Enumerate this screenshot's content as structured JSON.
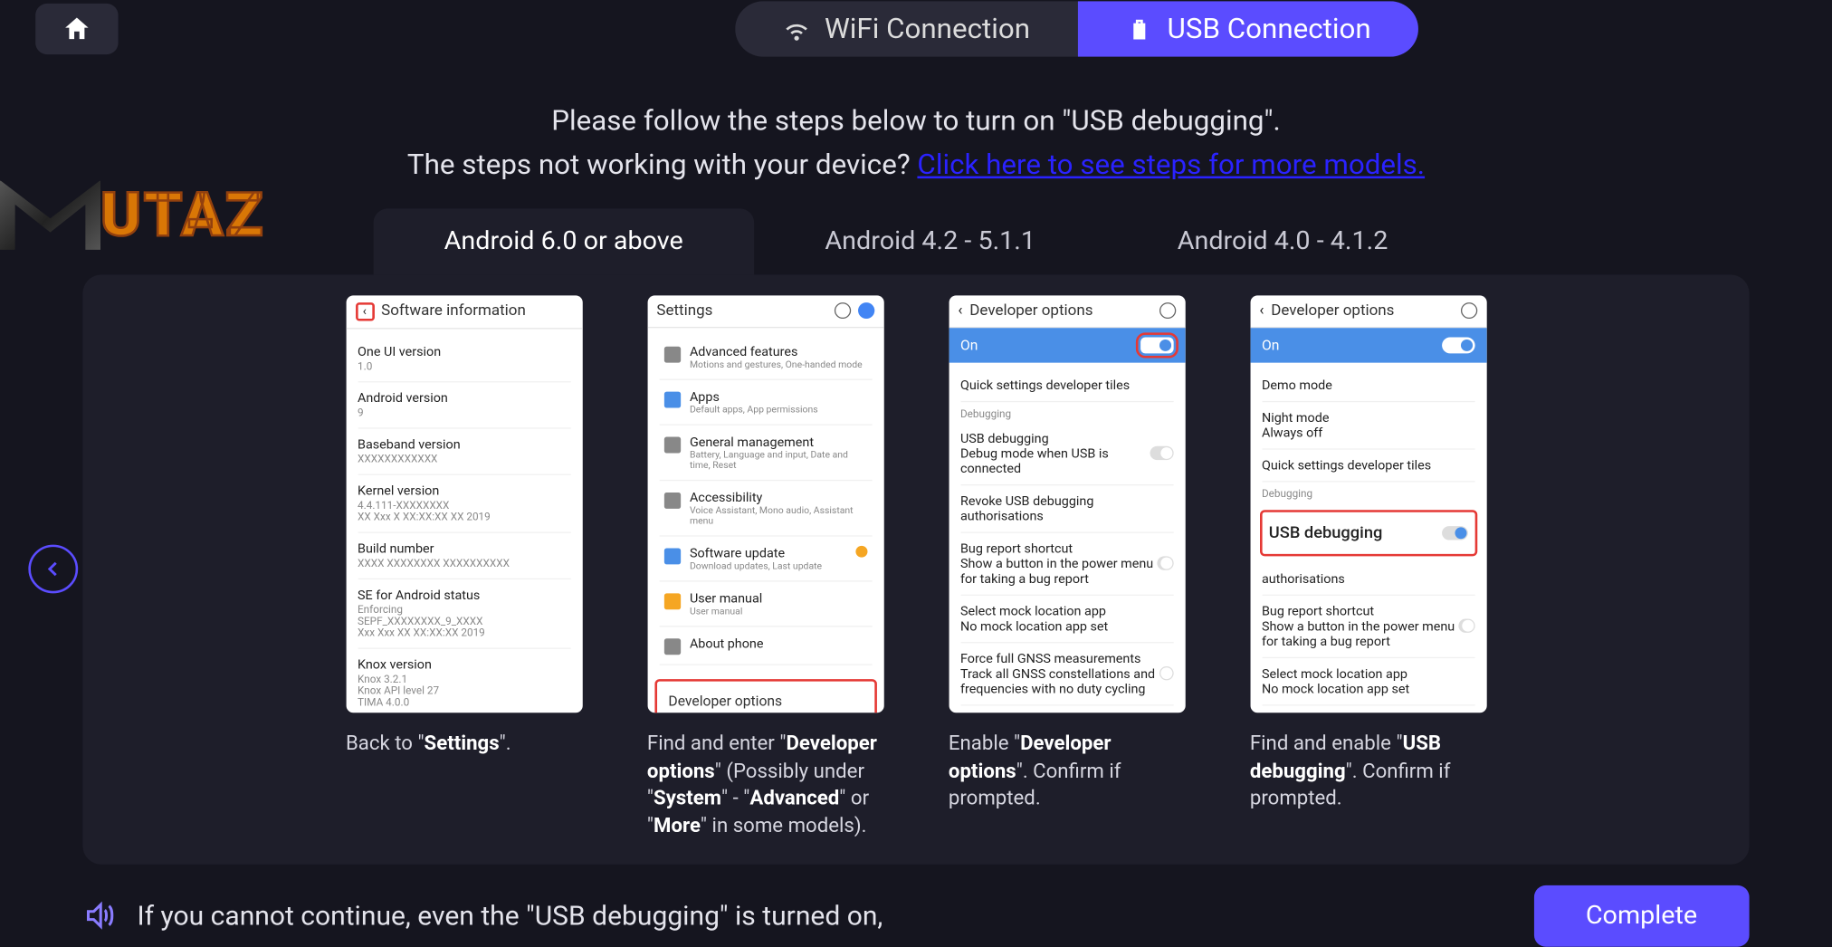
{
  "topbar": {
    "wifi_label": "WiFi Connection",
    "usb_label": "USB Connection"
  },
  "instruction": {
    "line1": "Please follow the steps below to turn on \"USB debugging\".",
    "line2_prefix": "The steps not working with your device? ",
    "link_text": "Click here to see steps for more models."
  },
  "watermark": "UTAZ",
  "android_tabs": {
    "tab1": "Android 6.0 or above",
    "tab2": "Android 4.2 - 5.1.1",
    "tab3": "Android 4.0 - 4.1.2"
  },
  "phone1": {
    "header": "Software information",
    "items": [
      {
        "t": "One UI version",
        "s": "1.0"
      },
      {
        "t": "Android version",
        "s": "9"
      },
      {
        "t": "Baseband version",
        "s": "XXXXXXXXXXXX"
      },
      {
        "t": "Kernel version",
        "s": "4.4.111-XXXXXXXX\nXX Xxx X XX:XX:XX XX 2019"
      },
      {
        "t": "Build number",
        "s": "XXXX XXXXXXXX XXXXXXXXXX"
      },
      {
        "t": "SE for Android status",
        "s": "Enforcing\nSEPF_XXXXXXXX_9_XXXX\nXxx Xxx XX  XX:XX:XX 2019"
      },
      {
        "t": "Knox version",
        "s": "Knox 3.2.1\nKnox API level 27\nTIMA 4.0.0"
      }
    ]
  },
  "phone2": {
    "header": "Settings",
    "items": [
      {
        "t": "Advanced features",
        "s": "Motions and gestures, One-handed mode",
        "c": "#888"
      },
      {
        "t": "Apps",
        "s": "Default apps, App permissions",
        "c": "#4a8fe7"
      },
      {
        "t": "General management",
        "s": "Battery, Language and input, Date and time, Reset",
        "c": "#888"
      },
      {
        "t": "Accessibility",
        "s": "Voice Assistant, Mono audio, Assistant menu",
        "c": "#888"
      },
      {
        "t": "Software update",
        "s": "Download updates, Last update",
        "c": "#4a8fe7"
      },
      {
        "t": "User manual",
        "s": "User manual",
        "c": "#f5a623"
      },
      {
        "t": "About phone",
        "s": "",
        "c": "#888"
      }
    ],
    "dev_options": "Developer options"
  },
  "phone3": {
    "header": "Developer options",
    "bar": "On",
    "items": [
      {
        "t": "Quick settings developer tiles"
      },
      {
        "sect": "Debugging"
      },
      {
        "t": "USB debugging",
        "s": "Debug mode when USB is connected",
        "sw": true
      },
      {
        "t": "Revoke USB debugging authorisations"
      },
      {
        "t": "Bug report shortcut",
        "s": "Show a button in the power menu for taking a bug report",
        "sw": true
      },
      {
        "t": "Select mock location app",
        "s": "No mock location app set"
      },
      {
        "t": "Force full GNSS measurements",
        "s": "Track all GNSS constellations and frequencies with no duty cycling",
        "sw": true
      }
    ]
  },
  "phone4": {
    "header": "Developer options",
    "bar": "On",
    "usb_label": "USB debugging",
    "items_above": [
      {
        "t": "Demo mode"
      },
      {
        "t": "Night mode",
        "s": "Always off"
      },
      {
        "t": "Quick settings developer tiles"
      },
      {
        "sect": "Debugging"
      }
    ],
    "items_below": [
      {
        "t": "authorisations"
      },
      {
        "t": "Bug report shortcut",
        "s": "Show a button in the power menu for taking a bug report",
        "sw": true
      },
      {
        "t": "Select mock location app",
        "s": "No mock location app set"
      }
    ]
  },
  "captions": {
    "c1_pre": "Back to \"",
    "c1_b": "Settings",
    "c1_post": "\".",
    "c2_pre": "Find and enter \"",
    "c2_b1": "Developer options",
    "c2_mid": "\" (Possibly under \"",
    "c2_b2": "System",
    "c2_mid2": "\" - \"",
    "c2_b3": "Advanced",
    "c2_mid3": "\" or \"",
    "c2_b4": "More",
    "c2_post": "\" in some models).",
    "c3_pre": "Enable \"",
    "c3_b": "Developer options",
    "c3_post": "\". Confirm if prompted.",
    "c4_pre": "Find and enable \"",
    "c4_b": "USB debugging",
    "c4_post": "\". Confirm if prompted."
  },
  "footer": {
    "text": "If you cannot continue, even the \"USB debugging\" is turned on,",
    "complete": "Complete"
  }
}
